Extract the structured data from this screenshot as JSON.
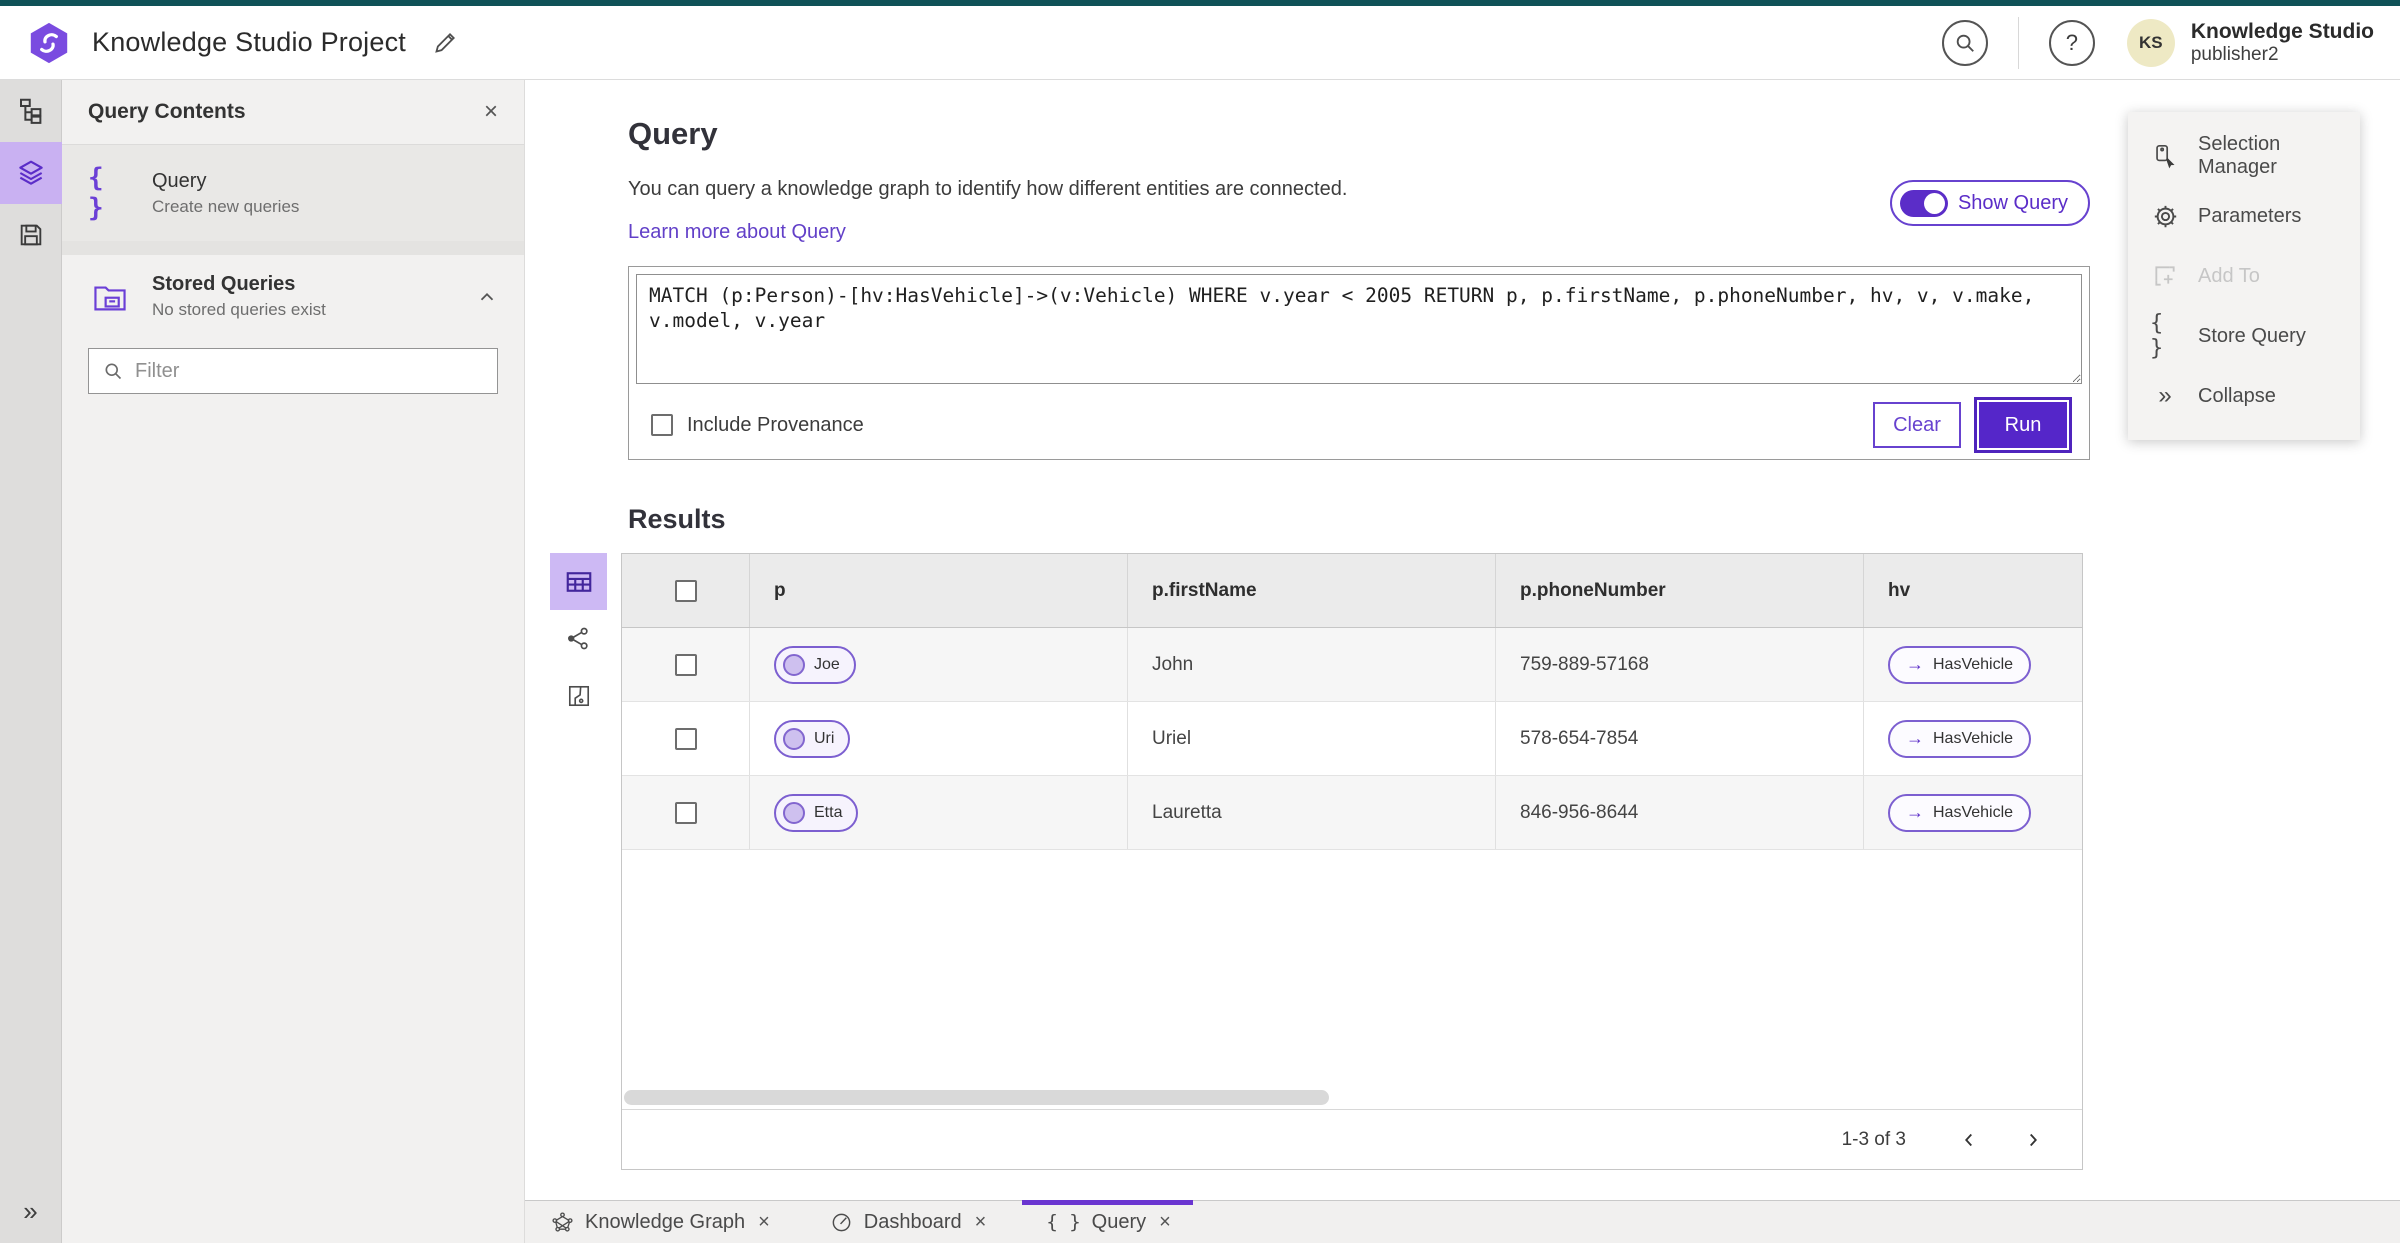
{
  "colors": {
    "accent_purple": "#5b2dc8",
    "accent_light_purple": "#c9b1f2",
    "chip_border_purple": "#7c5fd0",
    "topbar_teal": "#0f5257",
    "link_purple": "#6240c8",
    "avatar_yellow": "#eee9c4"
  },
  "glyphs": {
    "braces": "{ }",
    "arrow_right": "→",
    "close": "×",
    "collapse_chevrons": "»",
    "help": "?"
  },
  "header": {
    "title": "Knowledge Studio Project",
    "user": {
      "initials": "KS",
      "name": "Knowledge Studio",
      "role": "publisher2"
    }
  },
  "contents_panel": {
    "title": "Query Contents",
    "query_item": {
      "label": "Query",
      "description": "Create new queries"
    },
    "stored_item": {
      "label": "Stored Queries",
      "description": "No stored queries exist"
    },
    "filter_placeholder": "Filter"
  },
  "query": {
    "heading": "Query",
    "description": "You can query a knowledge graph to identify how different entities are connected.",
    "learn_more": "Learn more about Query",
    "show_query": "Show Query",
    "text": "MATCH (p:Person)-[hv:HasVehicle]->(v:Vehicle) WHERE v.year < 2005 RETURN p, p.firstName, p.phoneNumber, hv, v, v.make, v.model, v.year",
    "include_provenance": "Include Provenance",
    "clear": "Clear",
    "run": "Run"
  },
  "tools": {
    "selection_manager": "Selection Manager",
    "parameters": "Parameters",
    "add_to": "Add To",
    "store_query": "Store Query",
    "collapse": "Collapse"
  },
  "results": {
    "heading": "Results",
    "columns": {
      "p": "p",
      "first_name": "p.firstName",
      "phone": "p.phoneNumber",
      "hv": "hv"
    },
    "rows": [
      {
        "p": "Joe",
        "firstName": "John",
        "phone": "759-889-57168",
        "hv": "HasVehicle"
      },
      {
        "p": "Uri",
        "firstName": "Uriel",
        "phone": "578-654-7854",
        "hv": "HasVehicle"
      },
      {
        "p": "Etta",
        "firstName": "Lauretta",
        "phone": "846-956-8644",
        "hv": "HasVehicle"
      }
    ],
    "pagination": "1-3 of 3"
  },
  "tabs": [
    {
      "label": "Knowledge Graph"
    },
    {
      "label": "Dashboard"
    },
    {
      "label": "Query"
    }
  ]
}
